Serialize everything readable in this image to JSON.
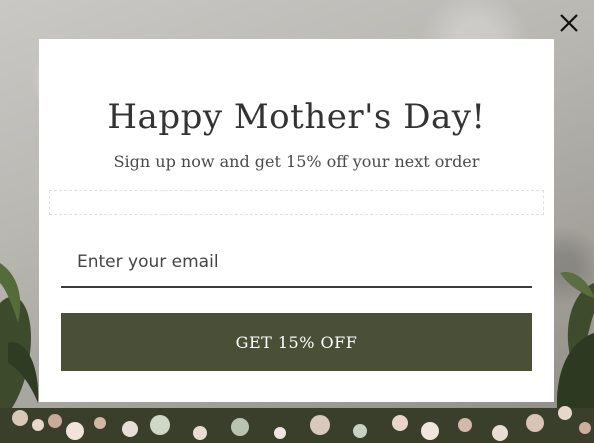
{
  "popup": {
    "title": "Happy Mother's Day!",
    "subtitle": "Sign up now and get 15% off your next order",
    "email_placeholder": "Enter your email",
    "email_value": "",
    "cta_label": "GET 15% OFF"
  },
  "colors": {
    "cta_background": "#4a4f37",
    "modal_background": "#ffffff",
    "title_text": "#333333"
  },
  "icons": {
    "close": "close-icon"
  }
}
